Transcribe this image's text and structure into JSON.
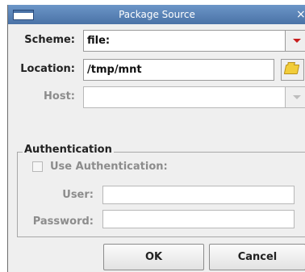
{
  "window": {
    "title": "Package Source",
    "close_glyph": "×"
  },
  "scheme": {
    "label": "Scheme:",
    "value": "file:"
  },
  "location": {
    "label": "Location:",
    "value": "/tmp/mnt",
    "browse_icon": "folder-icon"
  },
  "host": {
    "label": "Host:",
    "value": ""
  },
  "auth": {
    "group_title": "Authentication",
    "checkbox_label": "Use Authentication:",
    "checked": false,
    "user_label": "User:",
    "user_value": "",
    "password_label": "Password:",
    "password_value": ""
  },
  "buttons": {
    "ok": "OK",
    "cancel": "Cancel"
  },
  "colors": {
    "titlebar": "#5b84b8",
    "dialog_bg": "#efefef",
    "combo_arrow": "#c81e1e"
  }
}
